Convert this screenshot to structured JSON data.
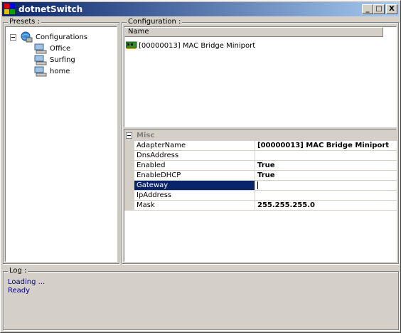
{
  "window": {
    "title": "dotnetSwitch"
  },
  "titlebar_buttons": {
    "minimize": "_",
    "maximize": "□",
    "close": "X"
  },
  "presets": {
    "label": "Presets :",
    "root": "Configurations",
    "items": [
      {
        "label": "Office"
      },
      {
        "label": "Surfing"
      },
      {
        "label": "home"
      }
    ]
  },
  "configuration": {
    "label": "Configuration :",
    "column_header": "Name",
    "items": [
      {
        "label": "[00000013] MAC Bridge Miniport"
      }
    ]
  },
  "property_grid": {
    "category": "Misc",
    "rows": [
      {
        "name": "AdapterName",
        "value": "[00000013] MAC Bridge Miniport"
      },
      {
        "name": "DnsAddress",
        "value": ""
      },
      {
        "name": "Enabled",
        "value": "True"
      },
      {
        "name": "EnableDHCP",
        "value": "True"
      },
      {
        "name": "Gateway",
        "value": ""
      },
      {
        "name": "IpAddress",
        "value": ""
      },
      {
        "name": "Mask",
        "value": "255.255.255.0"
      }
    ]
  },
  "log": {
    "label": "Log :",
    "lines": [
      "Loading ...",
      "Ready"
    ]
  },
  "colors": {
    "title_bar": "#0a246a",
    "selection": "#0a246a",
    "log_text": "#000080"
  }
}
